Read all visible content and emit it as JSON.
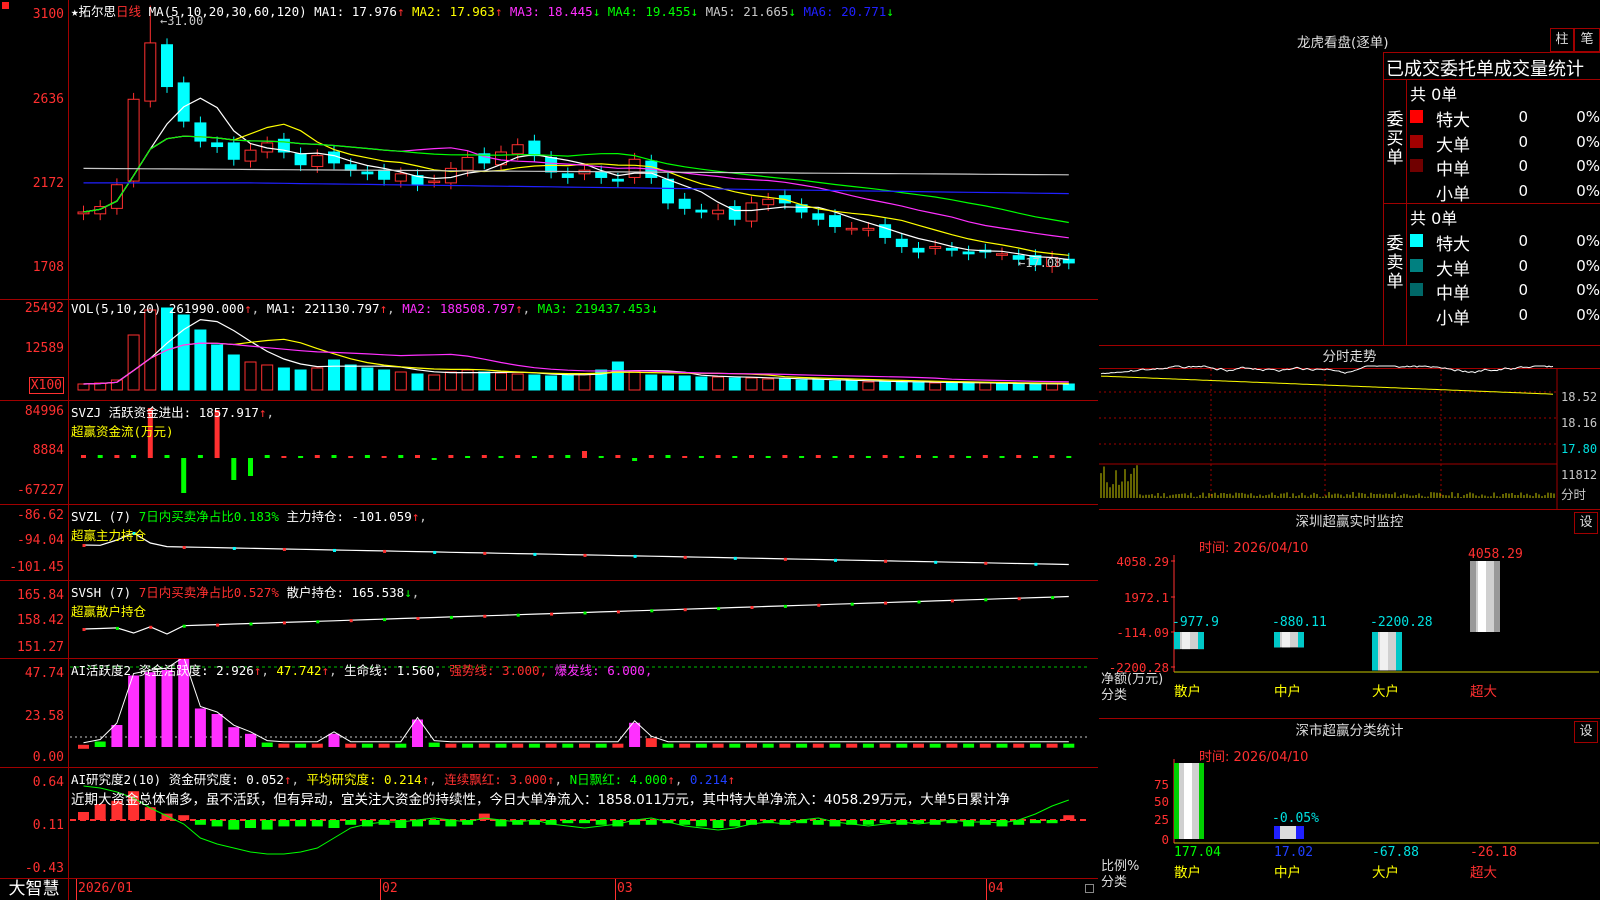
{
  "header": {
    "star": "★",
    "stock_name": "拓尔思",
    "period": "日线",
    "ma_label": "MA(5,10,20,30,60,120)",
    "ma": [
      {
        "label": "MA1:",
        "value": "17.976",
        "trend": "↑",
        "color": "#ffffff"
      },
      {
        "label": "MA2:",
        "value": "17.963",
        "trend": "↑",
        "color": "#ffff00"
      },
      {
        "label": "MA3:",
        "value": "18.445",
        "trend": "↓",
        "color": "#ff30ff"
      },
      {
        "label": "MA4:",
        "value": "19.455",
        "trend": "↓",
        "color": "#00ff00"
      },
      {
        "label": "MA5:",
        "value": "21.665",
        "trend": "↓",
        "color": "#c8c8c8"
      },
      {
        "label": "MA6:",
        "value": "20.771",
        "trend": "↓",
        "color": "#2020ff"
      }
    ],
    "high_mark": "31.00",
    "low_mark": "17.08"
  },
  "price_axis": [
    "3100",
    "2636",
    "2172",
    "1708"
  ],
  "vol": {
    "label": "VOL(5,10,20)",
    "value": "261990.000",
    "ma1": "MA1: 221130.797",
    "ma2": "MA2: 188508.797",
    "ma3": "MA3: 219437.453",
    "axis": [
      "25492",
      "12589",
      "X100"
    ]
  },
  "svzj": {
    "label": "SVZJ",
    "desc": "活跃资金进出: 1857.917",
    "sub": "超赢资金流(万元)",
    "axis": [
      "84996",
      "8884",
      "-67227"
    ]
  },
  "svzl": {
    "label": "SVZL (7)",
    "ratio": "7日内买卖净占比0.183%",
    "hold": "主力持仓: -101.059",
    "sub": "超赢主力持仓",
    "axis": [
      "-86.62",
      "-94.04",
      "-101.45"
    ]
  },
  "svsh": {
    "label": "SVSH (7)",
    "ratio": "7日内买卖净占比0.527%",
    "hold": "散户持仓: 165.538",
    "sub": "超赢散户持仓",
    "axis": [
      "165.84",
      "158.42",
      "151.27"
    ]
  },
  "ai_active": {
    "label": "AI活跃度2",
    "v1": "资金活跃度: 2.926",
    "v2": "47.742",
    "v3": "生命线: 1.560,",
    "v4": "强势线: 3.000,",
    "v5": "爆发线: 6.000,",
    "axis": [
      "47.74",
      "23.58",
      "0.00"
    ]
  },
  "ai_research": {
    "label": "AI研究度2(10)",
    "v1": "资金研究度: 0.052",
    "v2": "平均研究度: 0.214",
    "v3": "连续飘红: 3.000",
    "v4": "N日飘红: 4.000",
    "v5": "0.214",
    "text": "近期大资金总体偏多，虽不活跃，但有异动，宜关注大资金的持续性，今日大单净流入：1858.011万元，其中特大单净流入：4058.29万元，大单5日累计净",
    "axis": [
      "0.64",
      "0.11",
      "-0.43"
    ]
  },
  "bottom": {
    "logo": "大智慧",
    "dates": [
      "2026/01",
      "02",
      "03",
      "04"
    ]
  },
  "dragon": {
    "title": "龙虎看盘(逐单)",
    "btn1": "柱",
    "btn2": "笔",
    "subtitle": "已成交委托单成交量统计",
    "buy_label": "委买单",
    "sell_label": "委卖单",
    "buy_total": "共 0单",
    "sell_total": "共 0单",
    "buy_rows": [
      {
        "name": "特大",
        "count": "0",
        "pct": "0%",
        "color": "#ff0000"
      },
      {
        "name": "大单",
        "count": "0",
        "pct": "0%",
        "color": "#a00000"
      },
      {
        "name": "中单",
        "count": "0",
        "pct": "0%",
        "color": "#700000"
      },
      {
        "name": "小单",
        "count": "0",
        "pct": "0%",
        "color": ""
      }
    ],
    "sell_rows": [
      {
        "name": "特大",
        "count": "0",
        "pct": "0%",
        "color": "#00ffff"
      },
      {
        "name": "大单",
        "count": "0",
        "pct": "0%",
        "color": "#008080"
      },
      {
        "name": "中单",
        "count": "0",
        "pct": "0%",
        "color": "#006868"
      },
      {
        "name": "小单",
        "count": "0",
        "pct": "0%",
        "color": ""
      }
    ]
  },
  "intraday": {
    "title": "分时走势",
    "prices": [
      "18.52",
      "18.16",
      "17.80"
    ],
    "vol": "11812",
    "tag": "分时"
  },
  "monitor": {
    "title": "深圳超赢实时监控",
    "btn": "设",
    "time": "时间: 2026/04/10",
    "axis": [
      "4058.29",
      "1972.1",
      "-114.09",
      "-2200.28"
    ],
    "unit": "净额(万元)",
    "cat": "分类",
    "categories": [
      "散户",
      "中户",
      "大户",
      "超大"
    ],
    "values": [
      -977.9,
      -880.11,
      -2200.28,
      4058.29
    ],
    "value_labels": [
      "-977.9",
      "-880.11",
      "-2200.28",
      "4058.29"
    ]
  },
  "classify": {
    "title": "深市超赢分类统计",
    "btn": "设",
    "time": "时间: 2026/04/10",
    "axis": [
      "75",
      "50",
      "25",
      "0"
    ],
    "unit": "比例%",
    "cat": "分类",
    "categories": [
      "散户",
      "中户",
      "大户",
      "超大"
    ],
    "values": [
      177.04,
      17.02,
      -67.88,
      -26.18
    ],
    "value_labels": [
      "177.04",
      "17.02",
      "-67.88",
      "-26.18"
    ],
    "mid_label": "-0.05%"
  }
}
